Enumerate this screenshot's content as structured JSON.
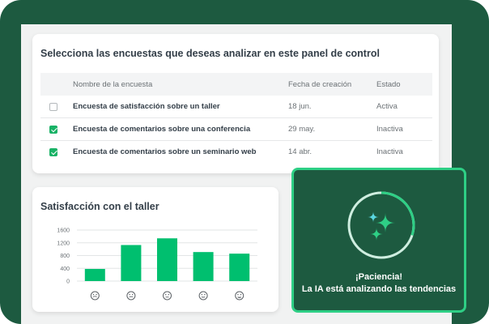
{
  "survey_panel": {
    "title": "Selecciona las encuestas que deseas analizar en este panel de control",
    "columns": {
      "name": "Nombre de la encuesta",
      "date": "Fecha de creación",
      "state": "Estado"
    },
    "rows": [
      {
        "name": "Encuesta de satisfacción sobre un taller",
        "date": "18 jun.",
        "state": "Activa",
        "checked": false
      },
      {
        "name": "Encuesta de comentarios sobre una conferencia",
        "date": "29 may.",
        "state": "Inactiva",
        "checked": true
      },
      {
        "name": "Encuesta de comentarios sobre un seminario web",
        "date": "14 abr.",
        "state": "Inactiva",
        "checked": true
      }
    ]
  },
  "chart_data": {
    "type": "bar",
    "title": "Satisfacción con el taller",
    "categories": [
      "very-dissatisfied-face-icon",
      "dissatisfied-face-icon",
      "neutral-face-icon",
      "satisfied-face-icon",
      "very-satisfied-face-icon"
    ],
    "values": [
      380,
      1130,
      1340,
      910,
      860
    ],
    "yticks": [
      "1600",
      "1200",
      "800",
      "400",
      "0"
    ],
    "ylim": [
      0,
      1600
    ],
    "grid": true,
    "bar_color": "#00bf6f"
  },
  "ai_panel": {
    "line1": "¡Paciencia!",
    "line2": "La IA está analizando las tendencias",
    "progress": 0.3,
    "ring_color": "#2ecf85",
    "sparkle_colors": [
      "#2ecf85",
      "#5ad6e0"
    ]
  },
  "colors": {
    "brand_dark": "#1d5a40",
    "accent": "#19b266"
  }
}
